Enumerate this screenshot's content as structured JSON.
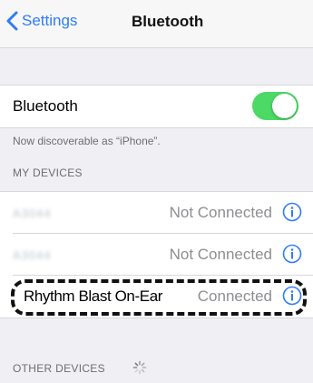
{
  "nav": {
    "back_label": "Settings",
    "title": "Bluetooth"
  },
  "bluetooth": {
    "label": "Bluetooth",
    "enabled": true,
    "discoverable_note": "Now discoverable as “iPhone”."
  },
  "my_devices": {
    "header": "MY DEVICES",
    "items": [
      {
        "name": "A3044",
        "status": "Not Connected"
      },
      {
        "name": "A3044",
        "status": "Not Connected"
      },
      {
        "name": "Rhythm Blast On-Ear",
        "status": "Connected"
      }
    ]
  },
  "other_devices": {
    "header": "OTHER DEVICES",
    "scanning": true
  },
  "colors": {
    "accent": "#2f7cf6",
    "toggle_on": "#4cd964",
    "secondary_text": "#8e8e93",
    "background": "#efeff4"
  },
  "icons": {
    "back": "chevron-left-icon",
    "info": "info-circle-icon",
    "spinner": "activity-spinner-icon"
  }
}
